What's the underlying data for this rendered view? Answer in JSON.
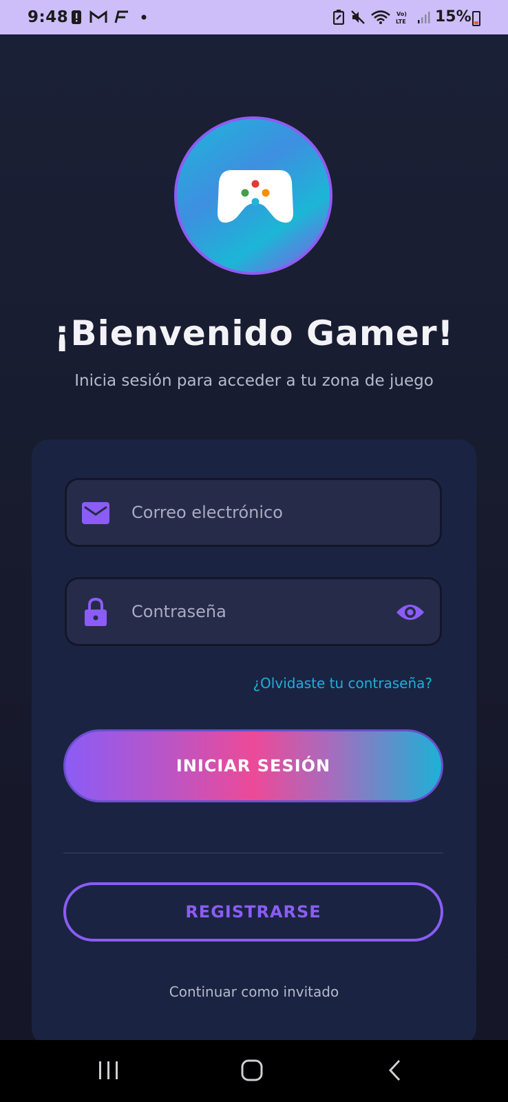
{
  "status_bar": {
    "time": "9:48",
    "battery": "15%",
    "icons": [
      "alert-icon",
      "gmail-icon",
      "app-f-icon",
      "dot-icon",
      "battery-saver-icon",
      "mute-icon",
      "wifi-icon",
      "volte-lte-icon",
      "signal-icon",
      "battery-icon"
    ]
  },
  "logo": {
    "icon": "gamepad-icon"
  },
  "header": {
    "title": "¡Bienvenido Gamer!",
    "subtitle": "Inicia sesión para acceder a tu zona de juego"
  },
  "form": {
    "email_placeholder": "Correo electrónico",
    "password_placeholder": "Contraseña",
    "forgot_password": "¿Olvidaste tu contraseña?",
    "login_button": "INICIAR SESIÓN",
    "register_button": "REGISTRARSE",
    "guest_link": "Continuar como invitado"
  },
  "colors": {
    "accent_purple": "#8b5cf6",
    "accent_cyan": "#1fb0d8",
    "accent_pink": "#ec4a98",
    "background": "#161b30",
    "card": "#1a2442",
    "status_bar": "#cdbefa"
  },
  "nav_bar": {
    "icons": [
      "recents-icon",
      "home-icon",
      "back-icon"
    ]
  }
}
